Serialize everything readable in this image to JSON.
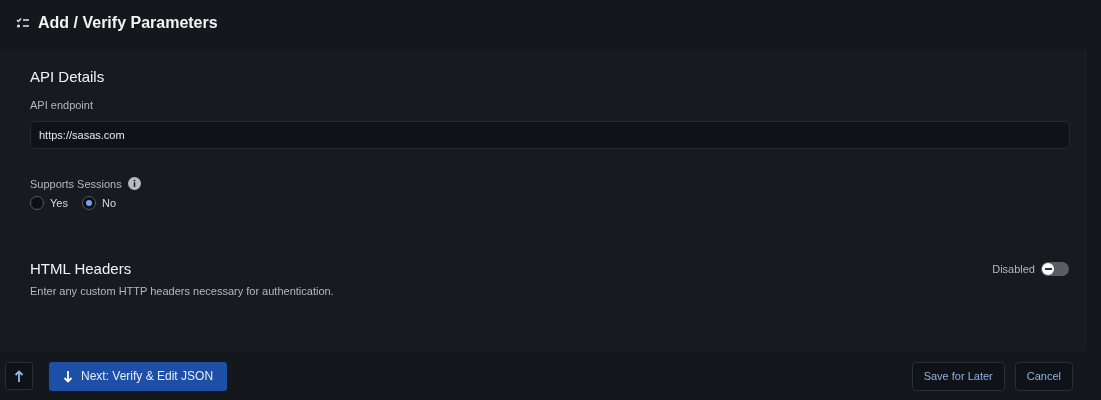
{
  "header": {
    "title": "Add / Verify Parameters"
  },
  "api_details": {
    "title": "API Details",
    "endpoint": {
      "label": "API endpoint",
      "value": "https://sasas.com"
    },
    "sessions": {
      "label": "Supports Sessions",
      "options": [
        {
          "label": "Yes",
          "selected": false
        },
        {
          "label": "No",
          "selected": true
        }
      ]
    }
  },
  "html_headers": {
    "title": "HTML Headers",
    "description": "Enter any custom HTTP headers necessary for authentication.",
    "toggle": {
      "label": "Disabled",
      "on": false
    }
  },
  "footer": {
    "next_button": "Next: Verify & Edit JSON",
    "buttons": [
      "Save for Later",
      "Cancel"
    ]
  }
}
